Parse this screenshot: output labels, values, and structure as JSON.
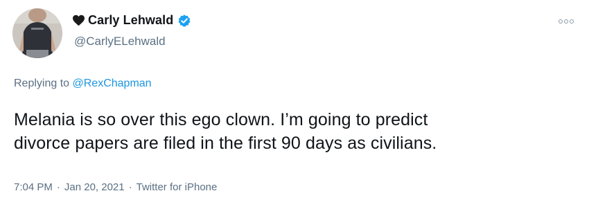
{
  "user": {
    "display_name": "Carly Lehwald",
    "handle": "@CarlyELehwald",
    "verified": true,
    "name_prefix_icon": "black-heart-icon"
  },
  "reply": {
    "prefix": "Replying to",
    "mention": "@RexChapman"
  },
  "tweet": {
    "text_line1": "Melania is so over this ego clown. I’m going to predict",
    "text_line2": "divorce papers are filed in the first 90 days as civilians."
  },
  "meta": {
    "time": "7:04 PM",
    "sep1": "·",
    "date": "Jan 20, 2021",
    "sep2": "·",
    "source": "Twitter for iPhone"
  },
  "colors": {
    "text": "#0f1419",
    "secondary": "#5b7083",
    "link": "#1b95e0",
    "verified": "#1da1f2"
  },
  "icons": {
    "more": "more-options-icon",
    "verified": "verified-badge-icon"
  }
}
